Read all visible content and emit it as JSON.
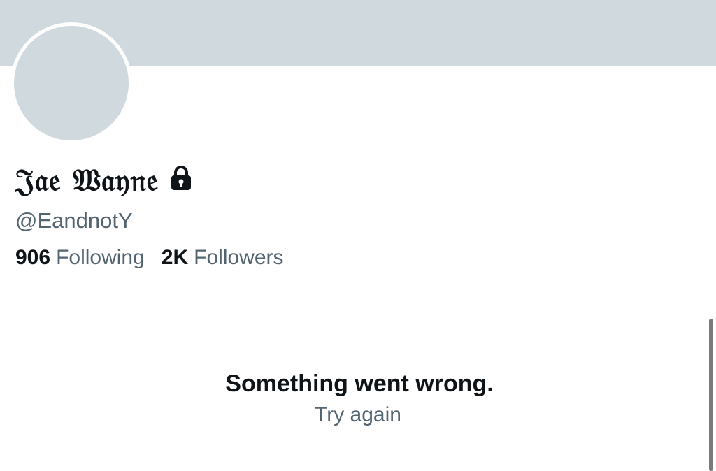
{
  "profile": {
    "display_name": "𝔍𝔞𝔢 𝔚𝔞𝔶𝔫𝔢",
    "handle": "@EandnotY",
    "protected_icon": "lock-icon",
    "following_count": "906",
    "following_label": "Following",
    "followers_count": "2K",
    "followers_label": "Followers"
  },
  "error": {
    "title": "Something went wrong.",
    "retry_label": "Try again"
  },
  "colors": {
    "banner": "#cfd9de",
    "avatar_placeholder": "#cfd9de",
    "text_primary": "#0f1419",
    "text_secondary": "#536471"
  }
}
